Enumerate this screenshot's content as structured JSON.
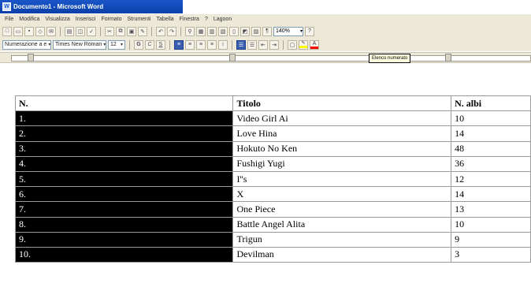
{
  "window": {
    "title": "Documento1 - Microsoft Word"
  },
  "menubar": {
    "items": [
      "File",
      "Modifica",
      "Visualizza",
      "Inserisci",
      "Formato",
      "Strumenti",
      "Tabella",
      "Finestra",
      "?",
      "Lagoon"
    ]
  },
  "toolbar": {
    "zoom": "140%",
    "style": "Numerazione a e",
    "font": "Times New Roman",
    "size": "12",
    "bold": "G",
    "italic": "C",
    "underline": "S"
  },
  "ruler": {
    "tooltip": "Elenco numerato"
  },
  "table": {
    "headers": [
      "N.",
      "Titolo",
      "N. albi"
    ],
    "rows": [
      {
        "n": "1.",
        "titolo": "Video Girl Ai",
        "albi": "10"
      },
      {
        "n": "2.",
        "titolo": "Love Hina",
        "albi": "14"
      },
      {
        "n": "3.",
        "titolo": "Hokuto No Ken",
        "albi": "48"
      },
      {
        "n": "4.",
        "titolo": "Fushigi Yugi",
        "albi": "36"
      },
      {
        "n": "5.",
        "titolo": "I''s",
        "albi": "12"
      },
      {
        "n": "6.",
        "titolo": "X",
        "albi": "14"
      },
      {
        "n": "7.",
        "titolo": "One Piece",
        "albi": "13"
      },
      {
        "n": "8.",
        "titolo": "Battle Angel Alita",
        "albi": "10"
      },
      {
        "n": "9.",
        "titolo": "Trigun",
        "albi": "9"
      },
      {
        "n": "10.",
        "titolo": "Devilman",
        "albi": "3"
      }
    ]
  },
  "colors": {
    "titlebar": "#1a56c8",
    "chrome": "#ece9d8",
    "selection": "#000000"
  }
}
